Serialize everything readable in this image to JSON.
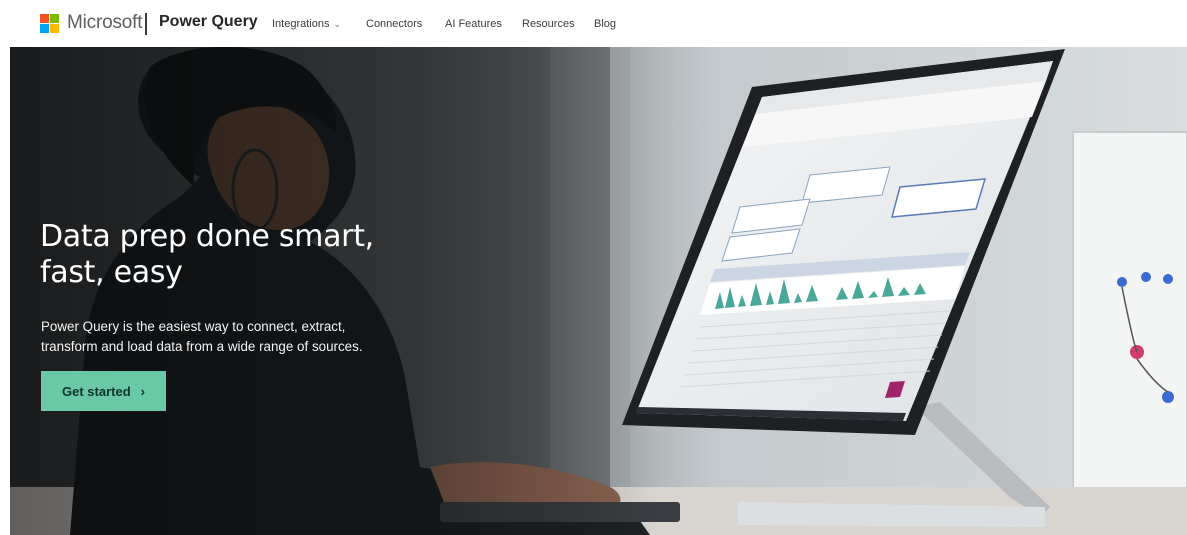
{
  "brand": {
    "company": "Microsoft",
    "product": "Power Query",
    "logo_colors": [
      "#f25022",
      "#7fba00",
      "#00a4ef",
      "#ffb900"
    ]
  },
  "nav": {
    "items": [
      {
        "label": "Integrations",
        "has_dropdown": true,
        "icon": "chevron-down-icon"
      },
      {
        "label": "Connectors",
        "has_dropdown": false
      },
      {
        "label": "AI Features",
        "has_dropdown": false
      },
      {
        "label": "Resources",
        "has_dropdown": false
      },
      {
        "label": "Blog",
        "has_dropdown": false
      }
    ]
  },
  "hero": {
    "title_line1": "Data prep done smart,",
    "title_line2": "fast, easy",
    "subtitle_line1": "Power Query is the easiest way to connect, extract,",
    "subtitle_line2": "transform and load data from a wide range of sources.",
    "cta_label": "Get started",
    "cta_icon": "chevron-right-icon",
    "cta_color": "#69c8a6"
  }
}
